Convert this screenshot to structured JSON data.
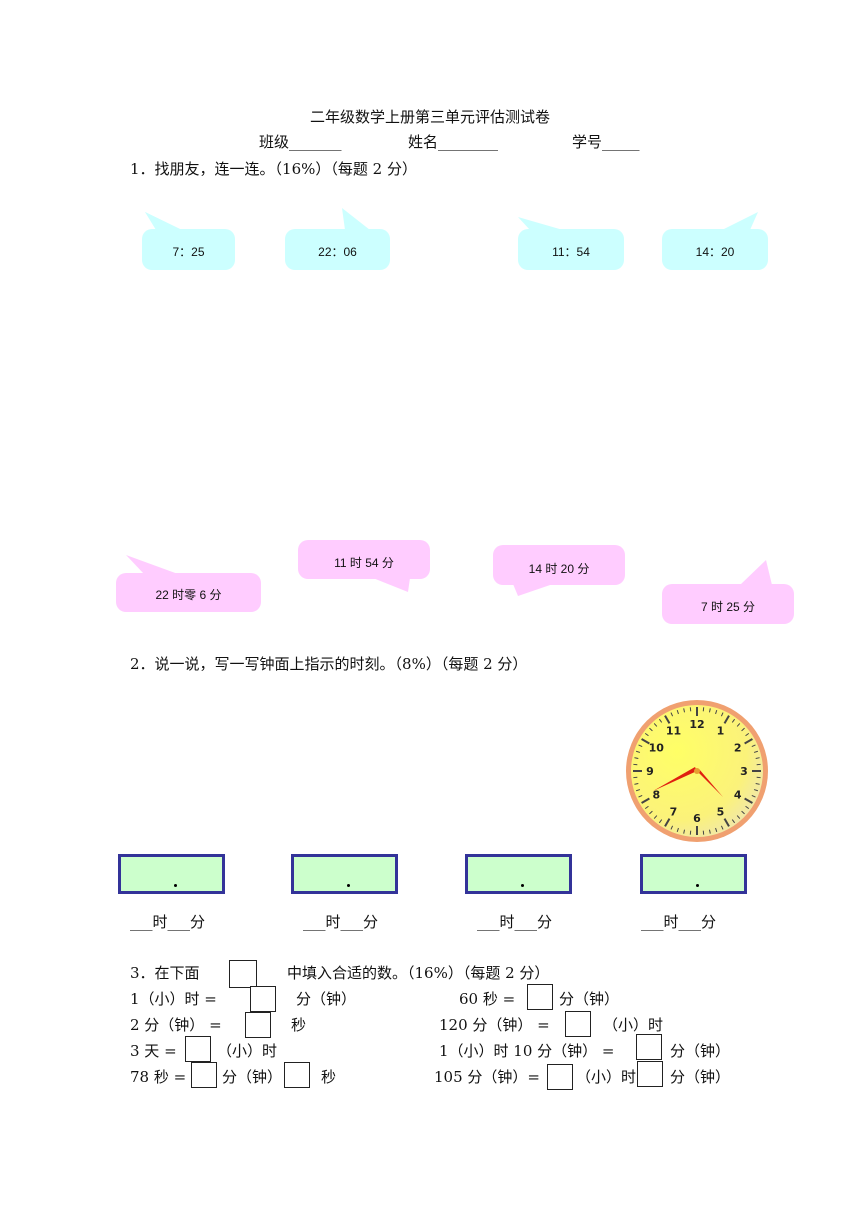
{
  "header": {
    "title": "二年级数学上册第三单元评估测试卷",
    "class_label": "班级_______",
    "name_label": "姓名________",
    "number_label": "学号_____"
  },
  "q1": {
    "heading": "1．找朋友，连一连。（16%）（每题 2 分）",
    "top_bubbles": [
      "7：25",
      "22：06",
      "11：54",
      "14：20"
    ],
    "bottom_bubbles": [
      "22 时零 6 分",
      "11 时 54 分",
      "14 时 20 分",
      "7 时 25 分"
    ],
    "colors": {
      "top": "#ccffff",
      "bottom": "#ffccff"
    }
  },
  "q2": {
    "heading": "2．说一说，写一写钟面上指示的时刻。（8%）（每题 2 分）",
    "clock_numbers": [
      "12",
      "1",
      "2",
      "3",
      "4",
      "5",
      "6",
      "7",
      "8",
      "9",
      "10",
      "11"
    ],
    "answer_boxes": [
      ".",
      ".",
      ".",
      "."
    ],
    "answer_labels": [
      "___时___分",
      "___时___分",
      "___时___分",
      "___时___分"
    ],
    "colors": {
      "box_fill": "#ccffcc",
      "box_border": "#333399",
      "clock_face": "#ffff66",
      "clock_rim": "#f0a070"
    }
  },
  "q3": {
    "heading_a": "3．在下面",
    "heading_b": "中填入合适的数。（16%）（每题 2 分）",
    "left": [
      {
        "a": "1（小）时 =",
        "b": "分（钟）"
      },
      {
        "a": "2 分（钟） =",
        "b": "秒"
      },
      {
        "a": "3 天 =",
        "b": "（小）时"
      },
      {
        "a": "78 秒 =",
        "b": "分（钟）",
        "c": "秒"
      }
    ],
    "right": [
      {
        "a": "60 秒 =",
        "b": "分（钟）"
      },
      {
        "a": "120 分（钟） =",
        "b": "（小）时"
      },
      {
        "a": "1（小）时 10 分（钟） =",
        "b": "分（钟）"
      },
      {
        "a": "105 分（钟）=",
        "b": "（小）时",
        "c": "分（钟）"
      }
    ]
  }
}
